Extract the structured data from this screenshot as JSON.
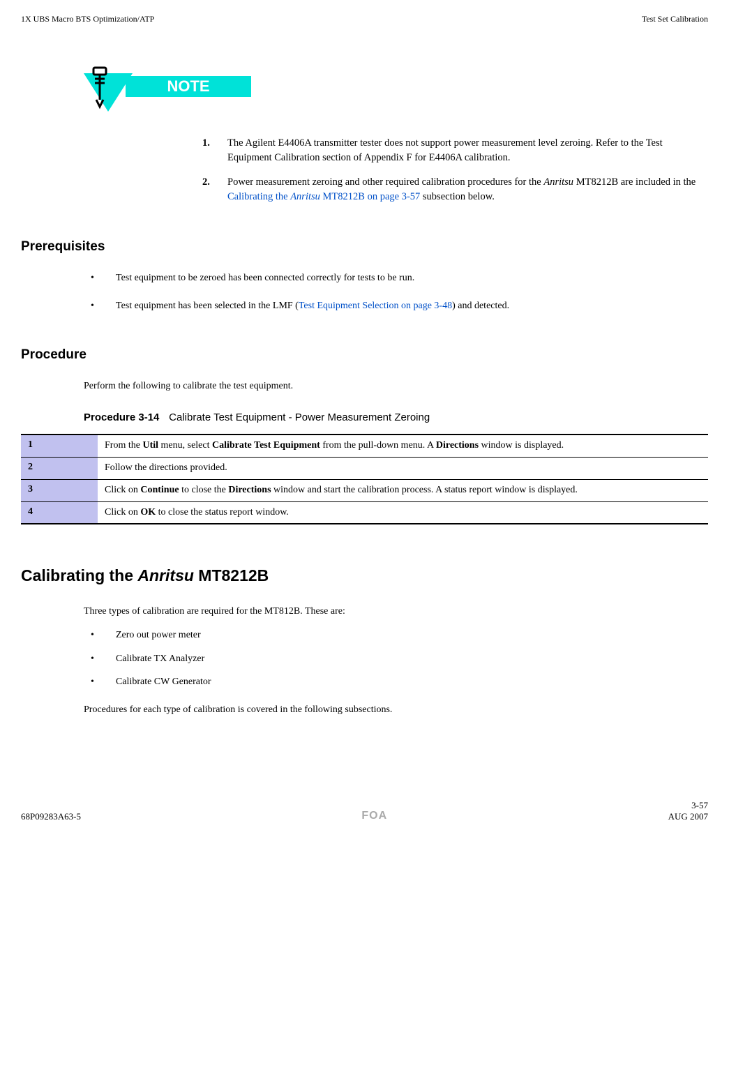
{
  "header": {
    "left": "1X UBS Macro BTS Optimization/ATP",
    "right": "Test Set Calibration"
  },
  "note": {
    "label": "NOTE",
    "items": [
      {
        "num": "1.",
        "text_pre": "The Agilent E4406A transmitter tester does not support power measurement level zeroing. Refer to the Test Equipment Calibration section of Appendix F for E4406A calibration."
      },
      {
        "num": "2.",
        "text_pre": "Power measurement zeroing and other required calibration procedures for the ",
        "italic1": "Anritsu",
        "text_mid": " MT8212B are included in the ",
        "link_pre": "Calibrating the ",
        "link_italic": "Anritsu",
        "link_post": " MT8212B on page 3-57",
        "text_post": " subsection below."
      }
    ]
  },
  "prereq": {
    "heading": "Prerequisites",
    "items": [
      {
        "text": "Test equipment to be zeroed has been connected correctly for tests to be run."
      },
      {
        "pre": "Test equipment has been selected in the LMF (",
        "link": "Test Equipment Selection on page 3-48",
        "post": ") and detected."
      }
    ]
  },
  "procedure_section": {
    "heading": "Procedure",
    "intro": "Perform the following to calibrate the test equipment.",
    "label": "Procedure 3-14",
    "title": "Calibrate Test Equipment - Power Measurement Zeroing",
    "rows": [
      {
        "step": "1",
        "pre": "From the ",
        "b1": "Util",
        "mid1": " menu, select ",
        "b2": "Calibrate Test Equipment",
        "mid2": " from the pull-down menu. A ",
        "b3": "Directions",
        "post": " window is displayed."
      },
      {
        "step": "2",
        "text": "Follow the directions provided."
      },
      {
        "step": "3",
        "pre": "Click on ",
        "b1": "Continue",
        "mid1": " to close the ",
        "b2": "Directions",
        "post": " window and start the calibration process. A status report window is displayed."
      },
      {
        "step": "4",
        "pre": "Click on ",
        "b1": "OK",
        "post": " to close the status report window."
      }
    ]
  },
  "calibrating": {
    "heading_pre": "Calibrating the ",
    "heading_italic": "Anritsu",
    "heading_post": " MT8212B",
    "intro": "Three types of calibration are required for the MT812B. These are:",
    "items": [
      "Zero out power meter",
      "Calibrate TX Analyzer",
      "Calibrate CW Generator"
    ],
    "outro": "Procedures for each type of calibration is covered in the following subsections."
  },
  "footer": {
    "left": "68P09283A63-5",
    "center": "FOA",
    "right_page": "3-57",
    "right_date": "AUG 2007"
  }
}
